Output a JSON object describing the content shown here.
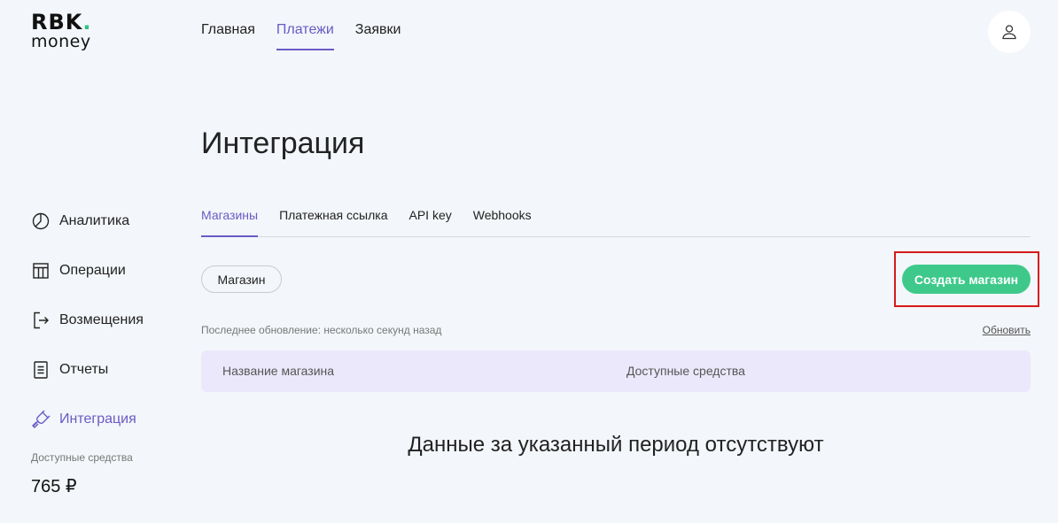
{
  "logo": {
    "top": "RBK",
    "dot": ".",
    "bottom": "money"
  },
  "top_nav": [
    {
      "label": "Главная",
      "active": false
    },
    {
      "label": "Платежи",
      "active": true
    },
    {
      "label": "Заявки",
      "active": false
    }
  ],
  "user": {
    "icon": "user-icon"
  },
  "sidebar": {
    "items": [
      {
        "label": "Аналитика",
        "icon": "pie-chart-icon"
      },
      {
        "label": "Операции",
        "icon": "table-icon"
      },
      {
        "label": "Возмещения",
        "icon": "refund-icon"
      },
      {
        "label": "Отчеты",
        "icon": "document-icon"
      },
      {
        "label": "Интеграция",
        "icon": "plug-icon",
        "active": true
      }
    ],
    "funds_label": "Доступные средства",
    "funds_value": "765 ₽"
  },
  "page": {
    "title": "Интеграция",
    "tabs": [
      {
        "label": "Магазины",
        "active": true
      },
      {
        "label": "Платежная ссылка"
      },
      {
        "label": "API key"
      },
      {
        "label": "Webhooks"
      }
    ],
    "filter_chip": "Магазин",
    "create_button": "Создать магазин",
    "last_update": "Последнее обновление: несколько секунд назад",
    "refresh": "Обновить",
    "table": {
      "columns": [
        "Название магазина",
        "Доступные средства"
      ]
    },
    "empty_message": "Данные за указанный период отсутствуют"
  },
  "colors": {
    "accent": "#6b5ac6",
    "brand_green": "#3ec98b",
    "table_header_bg": "#ece8fb",
    "highlight": "#d61a1a",
    "background": "#f3f6fa"
  }
}
